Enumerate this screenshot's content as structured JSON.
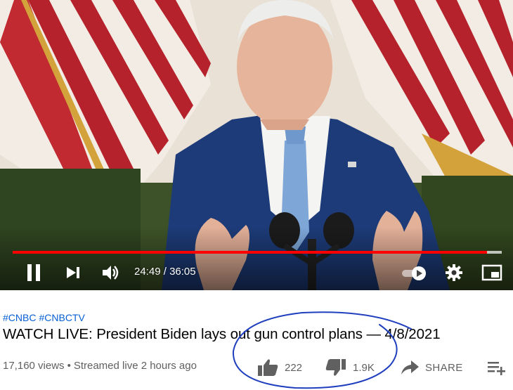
{
  "player": {
    "current_time": "24:49",
    "separator": " / ",
    "duration": "36:05",
    "progress_fraction": 0.97,
    "buffered_fraction": 1.0,
    "progress_color": "#ff0000"
  },
  "video": {
    "hashtags": [
      "#CNBC",
      "#CNBCTV"
    ],
    "title": "WATCH LIVE: President Biden lays out gun control plans — 4/8/2021",
    "views": "17,160 views",
    "streamed": "Streamed live 2 hours ago"
  },
  "actions": {
    "like_count": "222",
    "dislike_count": "1.9K",
    "share_label": "SHARE"
  },
  "colors": {
    "link": "#065fd4",
    "annotation_ink": "#1f3fbf"
  },
  "icons": [
    "pause-icon",
    "next-icon",
    "volume-icon",
    "autoplay-toggle",
    "settings-icon",
    "miniplayer-icon",
    "thumbs-up-icon",
    "thumbs-down-icon",
    "share-icon",
    "save-to-playlist-icon"
  ]
}
